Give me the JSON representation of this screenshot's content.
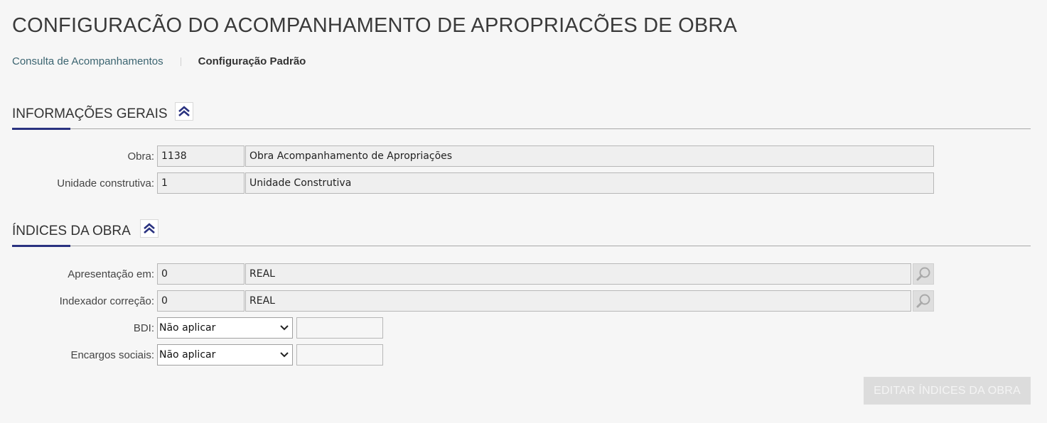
{
  "page_title": "CONFIGURACÃO DO ACOMPANHAMENTO DE APROPRIACÕES DE OBRA",
  "breadcrumb": {
    "link": "Consulta de Acompanhamentos",
    "current": "Configuração Padrão"
  },
  "informacoes_gerais": {
    "title": "INFORMAÇÕES GERAIS",
    "obra": {
      "label": "Obra:",
      "code": "1138",
      "description": "Obra Acompanhamento de Apropriações"
    },
    "unidade": {
      "label": "Unidade construtiva:",
      "code": "1",
      "description": "Unidade Construtiva"
    }
  },
  "indices_obra": {
    "title": "ÍNDICES DA OBRA",
    "apresentacao": {
      "label": "Apresentação em:",
      "code": "0",
      "description": "REAL"
    },
    "indexador": {
      "label": "Indexador correção:",
      "code": "0",
      "description": "REAL"
    },
    "bdi": {
      "label": "BDI:",
      "selected": "Não aplicar",
      "value": ""
    },
    "encargos": {
      "label": "Encargos sociais:",
      "selected": "Não aplicar",
      "value": ""
    },
    "edit_button": "EDITAR ÍNDICES DA OBRA"
  },
  "icons": {
    "collapse": "double-chevron-up-icon",
    "lookup": "magnifier-icon",
    "dropdown": "chevron-down-icon"
  },
  "colors": {
    "accent": "#2a3280",
    "link": "#3b6470",
    "disabled_button": "#dcdcdc"
  }
}
